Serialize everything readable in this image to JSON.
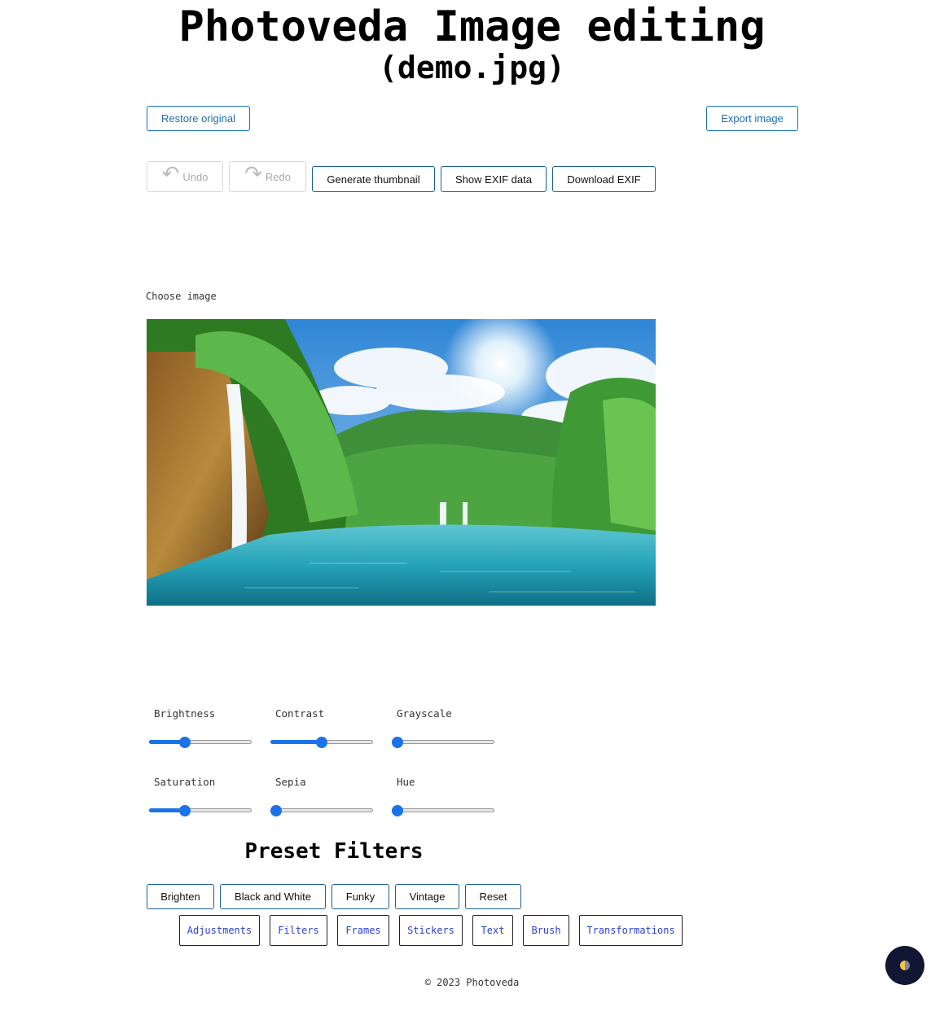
{
  "header": {
    "title": "Photoveda Image editing",
    "subtitle": "(demo.jpg)"
  },
  "toolbar": {
    "restore_label": "Restore original",
    "export_label": "Export image",
    "undo_label": "Undo",
    "redo_label": "Redo",
    "undo_icon": "undo-arrow-icon",
    "redo_icon": "redo-arrow-icon",
    "generate_thumbnail_label": "Generate thumbnail",
    "show_exif_label": "Show EXIF data",
    "download_exif_label": "Download EXIF"
  },
  "image": {
    "choose_label": "Choose image",
    "description": "waterfall-lake-forest-photo"
  },
  "adjustments": {
    "sliders": [
      {
        "label": "Brightness",
        "value": 0.33
      },
      {
        "label": "Contrast",
        "value": 0.5
      },
      {
        "label": "Grayscale",
        "value": 0
      },
      {
        "label": "Saturation",
        "value": 0.33
      },
      {
        "label": "Sepia",
        "value": 0
      },
      {
        "label": "Hue",
        "value": 0
      }
    ]
  },
  "presets": {
    "title": "Preset Filters",
    "buttons": [
      "Brighten",
      "Black and White",
      "Funky",
      "Vintage",
      "Reset"
    ]
  },
  "tabs": [
    "Adjustments",
    "Filters",
    "Frames",
    "Stickers",
    "Text",
    "Brush",
    "Transformations"
  ],
  "footer": {
    "copyright": "© 2023 Photoveda"
  },
  "theme_toggle": {
    "icon": "half-moon-theme-icon"
  },
  "colors": {
    "accent": "#1a73e8",
    "button_border": "#1a73b8",
    "tab_text": "#2a3fd8",
    "toggle_bg": "#111633"
  }
}
